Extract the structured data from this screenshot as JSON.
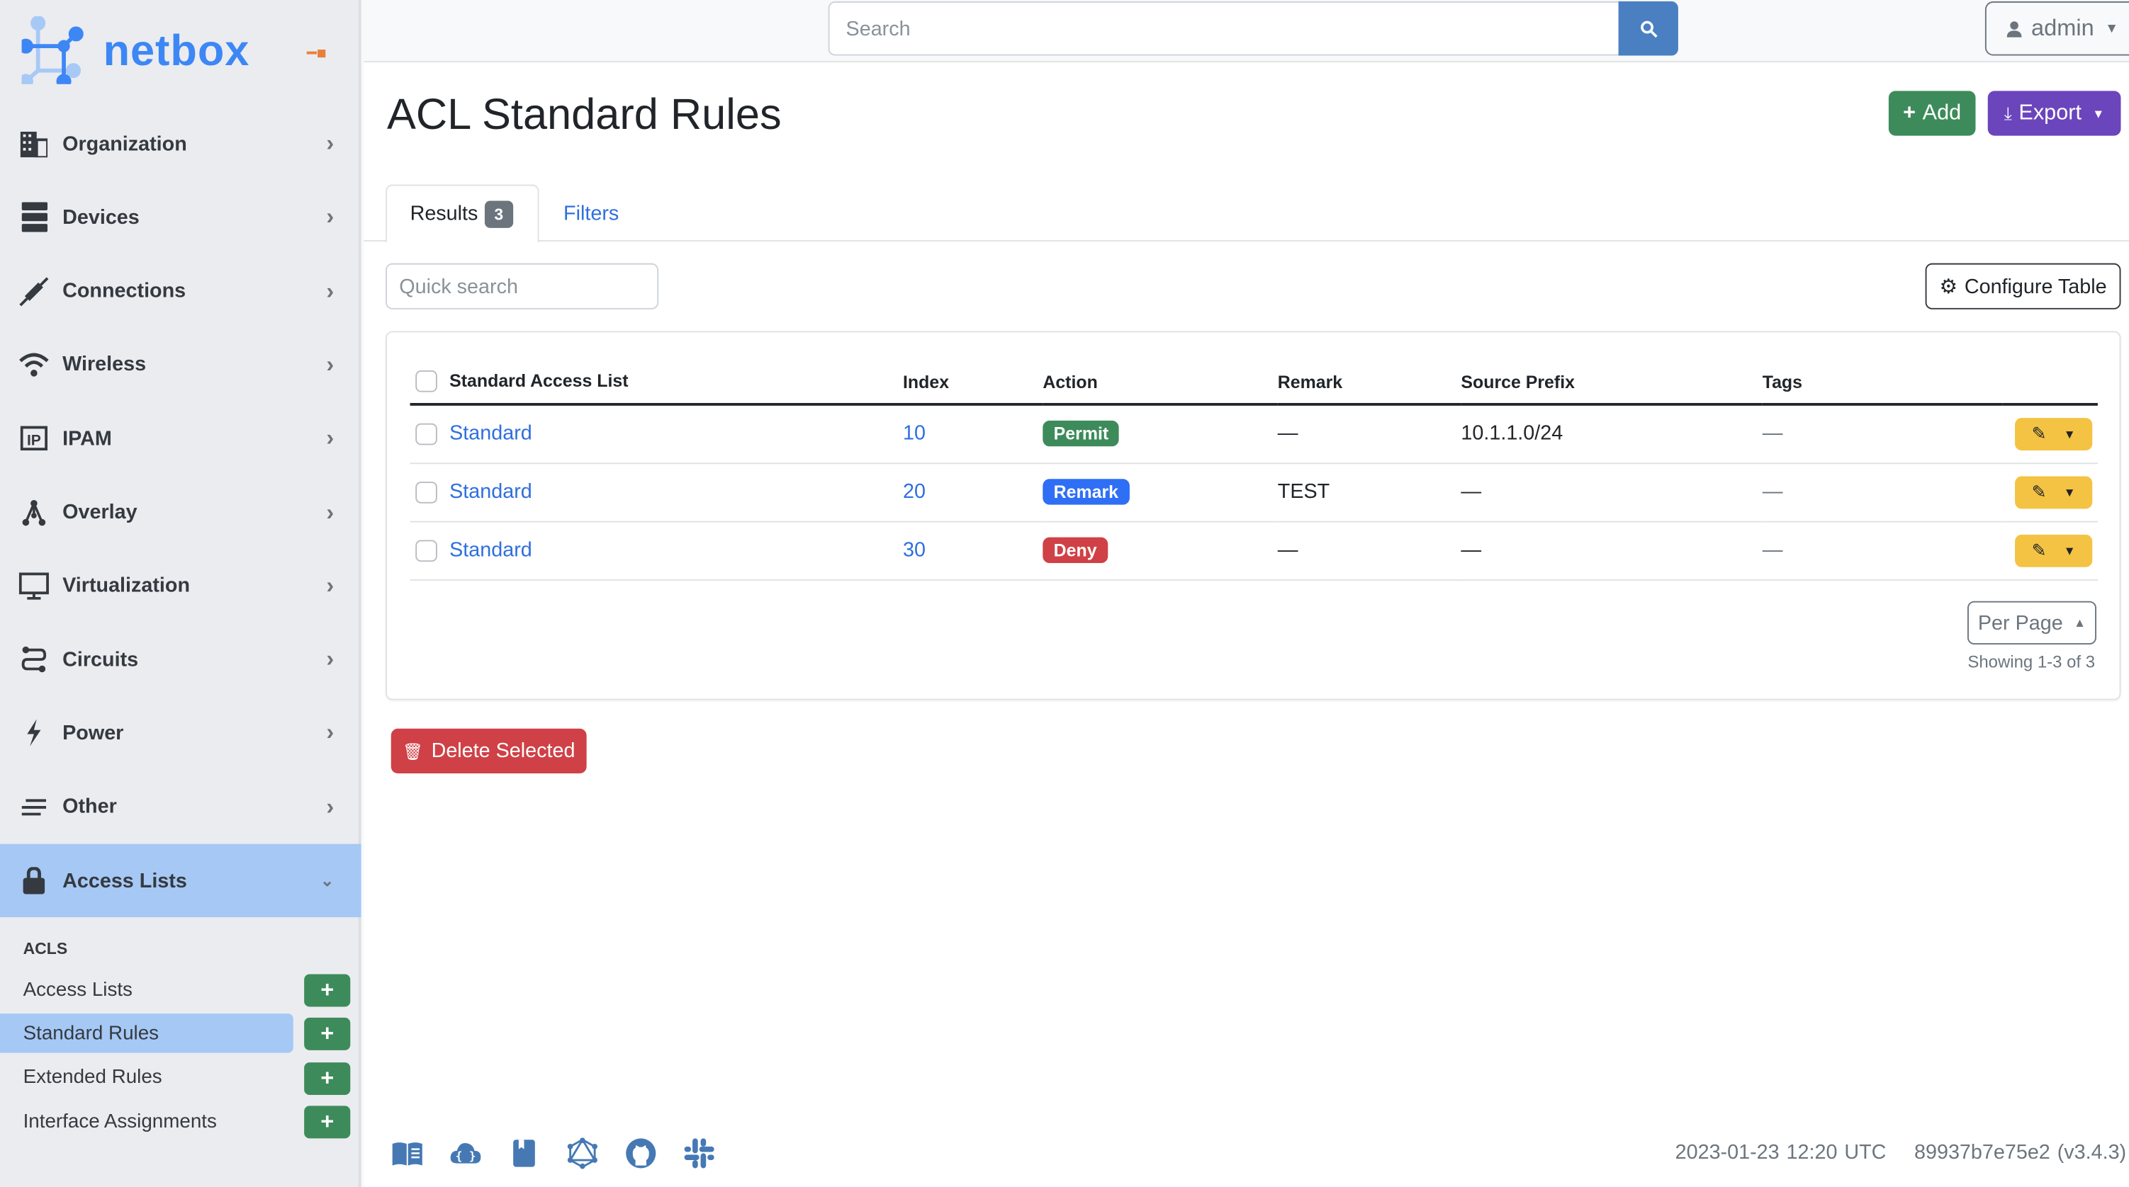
{
  "brand": {
    "name": "netbox",
    "color": "#3d87f5"
  },
  "sidebar": {
    "items": [
      {
        "label": "Organization",
        "icon": "building-icon"
      },
      {
        "label": "Devices",
        "icon": "server-icon"
      },
      {
        "label": "Connections",
        "icon": "plug-icon"
      },
      {
        "label": "Wireless",
        "icon": "wifi-icon"
      },
      {
        "label": "IPAM",
        "icon": "ip-icon"
      },
      {
        "label": "Overlay",
        "icon": "graph-icon"
      },
      {
        "label": "Virtualization",
        "icon": "monitor-icon"
      },
      {
        "label": "Circuits",
        "icon": "circuit-icon"
      },
      {
        "label": "Power",
        "icon": "lightning-icon"
      },
      {
        "label": "Other",
        "icon": "lines-icon"
      },
      {
        "label": "Access Lists",
        "icon": "lock-icon",
        "expanded": true
      }
    ],
    "section_label": "ACLS",
    "sub_items": [
      {
        "label": "Access Lists"
      },
      {
        "label": "Standard Rules",
        "active": true
      },
      {
        "label": "Extended Rules"
      },
      {
        "label": "Interface Assignments"
      }
    ],
    "add_symbol": "+"
  },
  "topbar": {
    "search_placeholder": "Search",
    "user": "admin"
  },
  "page": {
    "title": "ACL Standard Rules",
    "add_label": "Add",
    "export_label": "Export",
    "tabs": {
      "results": "Results",
      "results_count": "3",
      "filters": "Filters"
    },
    "quick_search_placeholder": "Quick search",
    "configure_label": "Configure Table",
    "columns": [
      "Standard Access List",
      "Index",
      "Action",
      "Remark",
      "Source Prefix",
      "Tags"
    ],
    "rows": [
      {
        "acl": "Standard",
        "index": "10",
        "action": "Permit",
        "action_color": "#3d8b5a",
        "remark": "—",
        "source_prefix": "10.1.1.0/24",
        "tags": "—"
      },
      {
        "acl": "Standard",
        "index": "20",
        "action": "Remark",
        "action_color": "#2f6ff5",
        "remark": "TEST",
        "source_prefix": "—",
        "tags": "—"
      },
      {
        "acl": "Standard",
        "index": "30",
        "action": "Deny",
        "action_color": "#cf4146",
        "remark": "—",
        "source_prefix": "—",
        "tags": "—"
      }
    ],
    "per_page_label": "Per Page",
    "showing": "Showing 1-3 of 3",
    "delete_label": "Delete Selected"
  },
  "footer": {
    "icons": [
      "book-icon",
      "api-cloud-icon",
      "bookmark-icon",
      "graphql-icon",
      "github-icon",
      "slack-icon"
    ],
    "timestamp": "2023-01-23 12:20 UTC",
    "version": "89937b7e75e2 (v3.4.3)"
  }
}
